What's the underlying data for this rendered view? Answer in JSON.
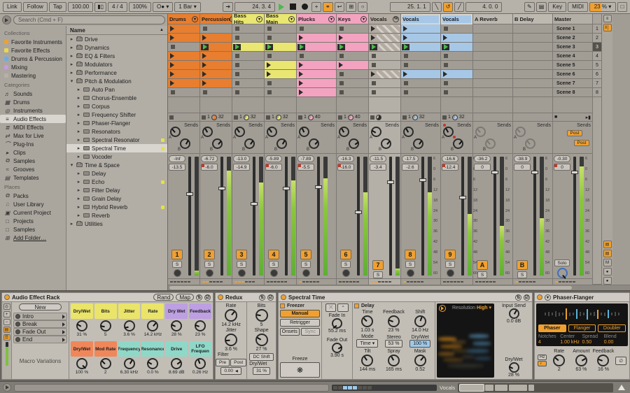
{
  "colors": {
    "orange": "#e87e2f",
    "yellow": "#e9e671",
    "pink": "#f3a3c0",
    "blue": "#a7c7e6",
    "gray": "#b3aba1",
    "black": "#333333",
    "return": "#bdb9b1",
    "master": "#b3afa7",
    "accent": "#f0a030"
  },
  "transport": {
    "left": [
      "Link",
      "Follow",
      "Tap"
    ],
    "tempo": "100.00",
    "signature": "4 / 4",
    "groove_amount": "100%",
    "quantize_menu": "O●",
    "launch_quantize": "1 Bar",
    "position": "24. 3. 4",
    "loop_start": "25. 1. 1",
    "loop_length": "4. 0. 0",
    "key_label": "Key",
    "midi_label": "MIDI",
    "cpu": "23 %"
  },
  "browser": {
    "search_placeholder": "Search (Cmd + F)",
    "sections": [
      {
        "title": "Collections",
        "items": [
          {
            "label": "Favorite Instruments",
            "dot": "#f0a030"
          },
          {
            "label": "Favorite Effects",
            "dot": "#e8d84a"
          },
          {
            "label": "Drums & Percussion",
            "dot": "#6aace8"
          },
          {
            "label": "Mixing",
            "dot": "#c79ae0"
          },
          {
            "label": "Mastering",
            "dot": "#b5b1a9"
          }
        ]
      },
      {
        "title": "Categories",
        "items": [
          {
            "label": "Sounds",
            "ico": "♬"
          },
          {
            "label": "Drums",
            "ico": "▦"
          },
          {
            "label": "Instruments",
            "ico": "◎"
          },
          {
            "label": "Audio Effects",
            "ico": "≡",
            "selected": true
          },
          {
            "label": "MIDI Effects",
            "ico": "≣"
          },
          {
            "label": "Max for Live",
            "ico": "⇄"
          },
          {
            "label": "Plug-Ins",
            "ico": "⌒"
          },
          {
            "label": "Clips",
            "ico": "▸"
          },
          {
            "label": "Samples",
            "ico": "⧉"
          },
          {
            "label": "Grooves",
            "ico": "≈"
          },
          {
            "label": "Templates",
            "ico": "▤"
          }
        ]
      },
      {
        "title": "Places",
        "items": [
          {
            "label": "Packs",
            "ico": "⧉"
          },
          {
            "label": "User Library",
            "ico": "♘"
          },
          {
            "label": "Current Project",
            "ico": "▣"
          },
          {
            "label": "Projects",
            "ico": "□"
          },
          {
            "label": "Samples",
            "ico": "□"
          },
          {
            "label": "Add Folder…",
            "ico": "⊞",
            "underline": true
          }
        ]
      }
    ],
    "tree_header": "Name",
    "tree": [
      {
        "label": "Drive",
        "d": 0,
        "kind": "folder"
      },
      {
        "label": "Dynamics",
        "d": 0,
        "kind": "folder"
      },
      {
        "label": "EQ & Filters",
        "d": 0,
        "kind": "folder"
      },
      {
        "label": "Modulators",
        "d": 0,
        "kind": "folder"
      },
      {
        "label": "Performance",
        "d": 0,
        "kind": "folder"
      },
      {
        "label": "Pitch & Modulation",
        "d": 0,
        "kind": "folder",
        "open": true
      },
      {
        "label": "Auto Pan",
        "d": 1,
        "kind": "dev"
      },
      {
        "label": "Chorus-Ensemble",
        "d": 1,
        "kind": "dev"
      },
      {
        "label": "Corpus",
        "d": 1,
        "kind": "dev"
      },
      {
        "label": "Frequency Shifter",
        "d": 1,
        "kind": "dev"
      },
      {
        "label": "Phaser-Flanger",
        "d": 1,
        "kind": "dev"
      },
      {
        "label": "Resonators",
        "d": 1,
        "kind": "dev"
      },
      {
        "label": "Spectral Resonator",
        "d": 1,
        "kind": "dev",
        "dot": true
      },
      {
        "label": "Spectral Time",
        "d": 1,
        "kind": "dev",
        "dot": true,
        "selected": true
      },
      {
        "label": "Vocoder",
        "d": 1,
        "kind": "dev"
      },
      {
        "label": "Time & Space",
        "d": 0,
        "kind": "folder",
        "open": true
      },
      {
        "label": "Delay",
        "d": 1,
        "kind": "dev"
      },
      {
        "label": "Echo",
        "d": 1,
        "kind": "dev",
        "dot": true
      },
      {
        "label": "Filter Delay",
        "d": 1,
        "kind": "dev"
      },
      {
        "label": "Grain Delay",
        "d": 1,
        "kind": "dev"
      },
      {
        "label": "Hybrid Reverb",
        "d": 1,
        "kind": "dev",
        "dot": true
      },
      {
        "label": "Reverb",
        "d": 1,
        "kind": "dev"
      },
      {
        "label": "Utilities",
        "d": 0,
        "kind": "folder"
      }
    ]
  },
  "session": {
    "scenes": [
      "Scene 1",
      "Scene 2",
      "Scene 3",
      "Scene 4",
      "Scene 5",
      "Scene 6",
      "Scene 7",
      "Scene 8"
    ],
    "scene_numbers": [
      "1",
      "2",
      "3",
      "4",
      "5",
      "6",
      "7",
      "8"
    ],
    "active_scene": 2,
    "sends_label": "Sends",
    "post_label": "Post",
    "solo_label": "S",
    "master_solo_label": "Solo",
    "scale": [
      "6",
      "0",
      "6",
      "12",
      "18",
      "24",
      "30",
      "36",
      "42",
      "48",
      "54",
      "60"
    ],
    "tracks": [
      {
        "name": "Drums",
        "color": "orange",
        "icon": "v",
        "clips": [
          "c",
          "c",
          "e",
          "c",
          "c",
          "c",
          "c",
          "e"
        ],
        "status": {
          "stop": true
        },
        "sends": {
          "a": -40,
          "b": 30
        },
        "mixer": {
          "peak": "-Inf",
          "val": "-13.5",
          "num": "1",
          "arm": true,
          "meter": 4,
          "fader": 30
        },
        "dash": 0
      },
      {
        "name": "Percussion",
        "color": "orange",
        "icon": "v",
        "clips": [
          "e",
          "c",
          "p",
          "c",
          "c",
          "c",
          "c",
          "e"
        ],
        "status": {
          "num": "1",
          "pie": "orange",
          "len": "32"
        },
        "sends": {
          "a": -30,
          "b": 40
        },
        "mixer": {
          "peak": "-6.72",
          "val": "-6.0",
          "flag": true,
          "num": "2",
          "arm": true,
          "meter": 88,
          "fader": 25
        },
        "dash": 2
      },
      {
        "name": "Bass Hits",
        "color": "yellow",
        "icon": "v",
        "clips": [
          "e",
          "e",
          "p",
          "e",
          "e",
          "e",
          "e",
          "e"
        ],
        "status": {
          "num": "1",
          "pie": "yellow",
          "len": "32"
        },
        "sends": {
          "a": -35,
          "b": 35
        },
        "mixer": {
          "peak": "-13.0",
          "val": "-14.9",
          "num": "3",
          "arm": true,
          "meter": 78,
          "fader": 38
        },
        "dash": 3
      },
      {
        "name": "Bass Main",
        "color": "yellow",
        "icon": "v",
        "clips": [
          "e",
          "e",
          "p",
          "e",
          "c",
          "c",
          "e",
          "e"
        ],
        "status": {
          "num": "1",
          "pie": "yellow",
          "len": "32"
        },
        "sends": {
          "a": -35,
          "b": 30
        },
        "mixer": {
          "peak": "-5.89",
          "val": "-6.0",
          "flag": true,
          "num": "4",
          "arm": true,
          "meter": 80,
          "fader": 25
        },
        "dash": 0
      },
      {
        "name": "Plucks",
        "color": "pink",
        "icon": "v",
        "wide": true,
        "clips": [
          "e",
          "c",
          "p",
          "e",
          "c",
          "c",
          "c",
          "c"
        ],
        "status": {
          "num": "1",
          "pie": "pink",
          "len": "40"
        },
        "sends": {
          "a": -25,
          "b": 45
        },
        "mixer": {
          "peak": "-7.89",
          "val": "-5.5",
          "flag": true,
          "num": "5",
          "arm": true,
          "meter": 82,
          "fader": 24
        },
        "dash": 1
      },
      {
        "name": "Keys",
        "color": "pink",
        "icon": "v",
        "clips": [
          "e",
          "c",
          "p",
          "e",
          "c",
          "e",
          "e",
          "e"
        ],
        "status": {
          "num": "1",
          "pie": "pink",
          "len": "40"
        },
        "sends": {
          "a": -30,
          "b": 55
        },
        "mixer": {
          "peak": "-16.3",
          "val": "-16.0",
          "flag": true,
          "num": "6",
          "arm": true,
          "meter": 70,
          "fader": 45
        },
        "dash": 0
      },
      {
        "name": "Vocals",
        "color": "gray",
        "icon": "o",
        "light": true,
        "hatch": true,
        "clips": [
          "c",
          "c",
          "p",
          "e",
          "e",
          "c",
          "e",
          "e"
        ],
        "status": {
          "pie": "black"
        },
        "sends": {
          "a": -60,
          "b": 40
        },
        "mixer": {
          "peak": "-11.5",
          "val": "-3.4",
          "num": "7",
          "arm": false,
          "meter": 6,
          "fader": 20
        },
        "dash": 2
      },
      {
        "name": "Vocals",
        "color": "blue",
        "wide": true,
        "selhd": true,
        "clips": [
          "c",
          "c",
          "p",
          "e",
          "e",
          "c",
          "e",
          "e"
        ],
        "status": {
          "num": "1",
          "pie": "blue",
          "len": "32"
        },
        "sends": {
          "a": -30,
          "b": 35
        },
        "mixer": {
          "peak": "-17.5",
          "val": "-2.6",
          "num": "8",
          "arm": true,
          "meter": 70,
          "fader": 18,
          "scale": true
        },
        "dash": 1
      },
      {
        "name": "Vocals",
        "color": "blue",
        "selhd": true,
        "clips": [
          "e",
          "c",
          "p",
          "e",
          "e",
          "c",
          "e",
          "e"
        ],
        "status": {
          "num": "1",
          "pie": "blue",
          "len": "32"
        },
        "sends": {
          "a": -30,
          "b": 40,
          "dots": true
        },
        "mixer": {
          "peak": "-16.6",
          "val": "-12.4",
          "flag": true,
          "num": "9",
          "arm": true,
          "meter": 52,
          "fader": 33,
          "scale": true
        },
        "dash": 0
      },
      {
        "name": "A Reverb",
        "color": "return",
        "kind": "return",
        "wide": true,
        "clips": [
          "n",
          "n",
          "n",
          "n",
          "n",
          "n",
          "n",
          "n"
        ],
        "status": {},
        "sends": {
          "a": -40,
          "b": -40,
          "dis": true
        },
        "mixer": {
          "peak": "-36.2",
          "val": "0",
          "num": "A",
          "arm": false,
          "meter": 42,
          "fader": 12,
          "scale": true
        },
        "dash": 0
      },
      {
        "name": "B Delay",
        "color": "return",
        "kind": "return",
        "wide": true,
        "clips": [
          "n",
          "n",
          "n",
          "n",
          "n",
          "n",
          "n",
          "n"
        ],
        "status": {},
        "sends": {
          "a": -40,
          "b": -40,
          "dis": true
        },
        "mixer": {
          "peak": "-38.9",
          "val": "0",
          "num": "B",
          "arm": false,
          "meter": 48,
          "fader": 12,
          "scale": true
        },
        "dash": 1
      },
      {
        "name": "Master",
        "color": "master",
        "kind": "master",
        "wide": true,
        "mixer": {
          "peak": "-0.30",
          "val": "0",
          "flag": true,
          "meter": 92,
          "fader": 12,
          "scale": true
        },
        "dash": 1
      }
    ]
  },
  "devices": {
    "rack": {
      "title": "Audio Effect Rack",
      "rand": "Rand",
      "map": "Map",
      "new_label": "New",
      "chains": [
        "Intro",
        "Break",
        "Fade Out",
        "End"
      ],
      "footer": "Macro Variations",
      "row1": [
        {
          "name": "Dry/Wet",
          "val": "31 %",
          "pc": "#eae46a",
          "a": -60
        },
        {
          "name": "Bits",
          "val": "5",
          "pc": "#eae46a",
          "a": -80
        },
        {
          "name": "Jitter",
          "val": "3.6 %",
          "pc": "#eae46a",
          "a": -100
        },
        {
          "name": "Rate",
          "val": "14.2 kHz",
          "pc": "#eae46a",
          "a": 40
        },
        {
          "name": "Dry Wet",
          "val": "28 %",
          "pc": "#bd9fe2",
          "a": -65
        },
        {
          "name": "Feedback",
          "val": "23 %",
          "pc": "#bd9fe2",
          "a": -70
        }
      ],
      "row2": [
        {
          "name": "Dry/Wet",
          "val": "100 %",
          "pc": "#f0875a",
          "a": 135
        },
        {
          "name": "Mod Rate",
          "val": "2",
          "pc": "#f0875a",
          "a": -45
        },
        {
          "name": "Frequency",
          "val": "6.30 kHz",
          "pc": "#8fd8c8",
          "a": 30
        },
        {
          "name": "Resonance",
          "val": "0.0 %",
          "pc": "#8fd8c8",
          "a": -60
        },
        {
          "name": "Drive",
          "val": "8.69 dB",
          "pc": "#8fd8c8",
          "a": 55
        },
        {
          "name": "LFO Frequen",
          "val": "0.26 Hz",
          "pc": "#8fd8c8",
          "a": -20
        }
      ]
    },
    "redux": {
      "title": "Redux",
      "rate": {
        "name": "Rate",
        "val": "14.2 kHz",
        "a": 40
      },
      "bits": {
        "name": "Bits",
        "val": "5",
        "a": -80
      },
      "jitter": {
        "name": "Jitter",
        "val": "3.6 %",
        "a": -95
      },
      "shape": {
        "name": "Shape",
        "val": "27 %",
        "a": -60
      },
      "filter_label": "Filter",
      "pre": "Pre",
      "post": "Post",
      "filter_val": "0.00",
      "dc": "DC Shift",
      "drywet_label": "Dry/Wet",
      "drywet": "31 %"
    },
    "spectral": {
      "title": "Spectral Time",
      "freezer": {
        "label": "Freezer",
        "manual": "Manual",
        "retrigger": "Retrigger",
        "onsets": "Onsets",
        "sync": "Sync",
        "fade_in_label": "Fade In",
        "fade_in": "55.2 ms",
        "fade_out_label": "Fade Out",
        "fade_out": "3.90 s",
        "freeze_label": "Freeze"
      },
      "delay": {
        "label": "Delay",
        "time_label": "Time",
        "time": "1.03 s",
        "fb_label": "Feedback",
        "fb": "23 %",
        "shift_label": "Shift",
        "shift": "14.0 Hz",
        "mode_label": "Mode",
        "mode": "Time",
        "stereo_label": "Stereo",
        "stereo": "53 %",
        "dw_label": "Dry/Wet",
        "dw": "100 %",
        "tilt_label": "Tilt",
        "tilt": "144 ms",
        "spray_label": "Spray",
        "spray": "165 ms",
        "mask_label": "Mask",
        "mask": "0.52"
      },
      "display": {
        "res_label": "Resolution",
        "res": "High"
      },
      "right": {
        "in_label": "Input Send",
        "in_val": "0.0 dB",
        "dw_label": "Dry/Wet",
        "dw_val": "28 %"
      }
    },
    "phaser": {
      "title": "Phaser-Flanger",
      "modes": [
        "Phaser",
        "Flanger",
        "Doubler"
      ],
      "active_mode": 0,
      "params": [
        {
          "l": "Notches",
          "v": "4"
        },
        {
          "l": "Center",
          "v": "1.00 kHz"
        },
        {
          "l": "Spread",
          "v": "0.50"
        },
        {
          "l": "Blend",
          "v": "0.00"
        }
      ],
      "hz": "Hz",
      "note": "♪",
      "rate": {
        "name": "Rate",
        "val": "2",
        "a": -50
      },
      "amount": {
        "name": "Amount",
        "val": "63 %",
        "a": 60
      },
      "feedback": {
        "name": "Feedback",
        "val": "16 %",
        "a": -70
      },
      "bars": [
        4,
        6,
        4,
        8,
        5,
        4,
        16,
        5,
        4,
        14,
        6,
        4,
        15,
        4,
        6,
        13,
        4,
        5,
        12,
        4,
        6,
        4
      ],
      "bar_colors": {
        "6": "#e8a030",
        "9": "#5ab4d8",
        "12": "#5ab4d8",
        "15": "#e8a030",
        "18": "#5ab4d8"
      }
    }
  },
  "status_bar": {
    "track_label": "Vocals"
  }
}
